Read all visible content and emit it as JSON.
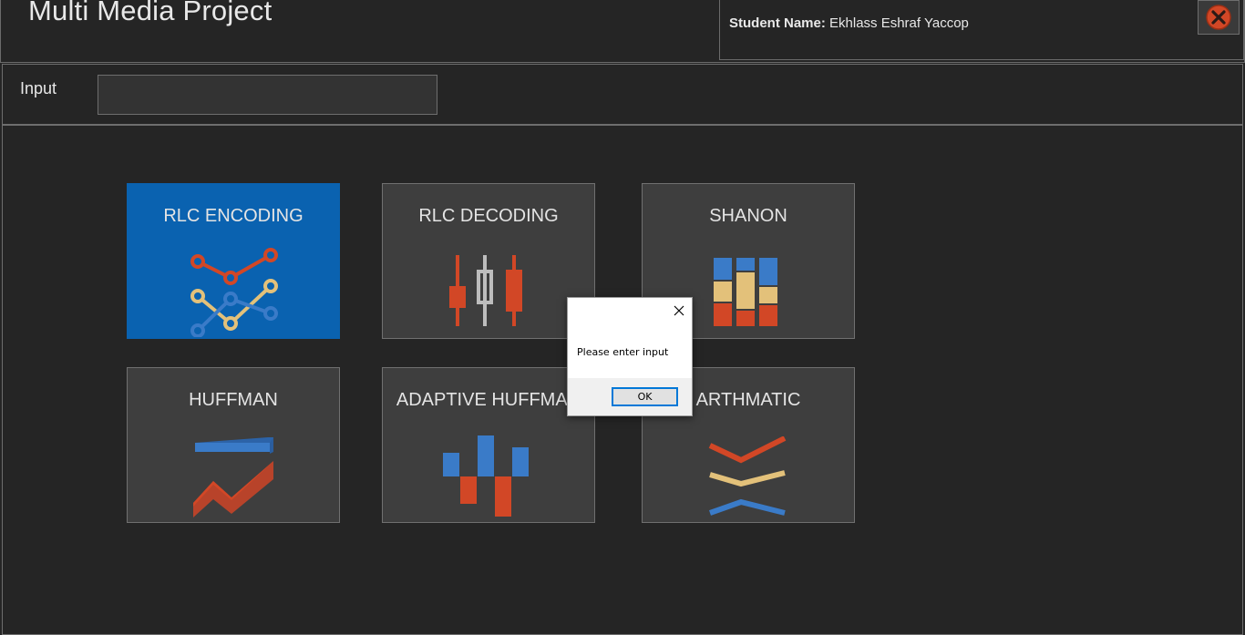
{
  "header": {
    "title": "Multi Media Project",
    "student_label": "Student Name:",
    "student_name": "Ekhlass Eshraf Yaccop",
    "close_icon": "close-circle-icon",
    "accent_close": "#d24726"
  },
  "input": {
    "label": "Input",
    "value": "",
    "placeholder": ""
  },
  "tiles": [
    {
      "label": "RLC ENCODING",
      "icon": "network-line-chart-icon",
      "selected": true
    },
    {
      "label": "RLC DECODING",
      "icon": "candlestick-chart-icon",
      "selected": false
    },
    {
      "label": "SHANON",
      "icon": "stacked-column-chart-icon",
      "selected": false
    },
    {
      "label": "HUFFMAN",
      "icon": "bar-and-line-chart-icon",
      "selected": false
    },
    {
      "label": "ADAPTIVE HUFFMAN",
      "icon": "waterfall-chart-icon",
      "selected": false
    },
    {
      "label": "ARTHMATIC",
      "icon": "chevron-stack-icon",
      "selected": false
    }
  ],
  "colors": {
    "background": "#252525",
    "tile": "#3e3e3e",
    "tile_selected": "#0a62b0",
    "red": "#d24726",
    "blue": "#3a7bc8",
    "tan": "#e3c17a",
    "gray": "#bdbdbd"
  },
  "dialog": {
    "message": "Please enter input",
    "ok_label": "OK",
    "close_icon": "close-icon"
  }
}
